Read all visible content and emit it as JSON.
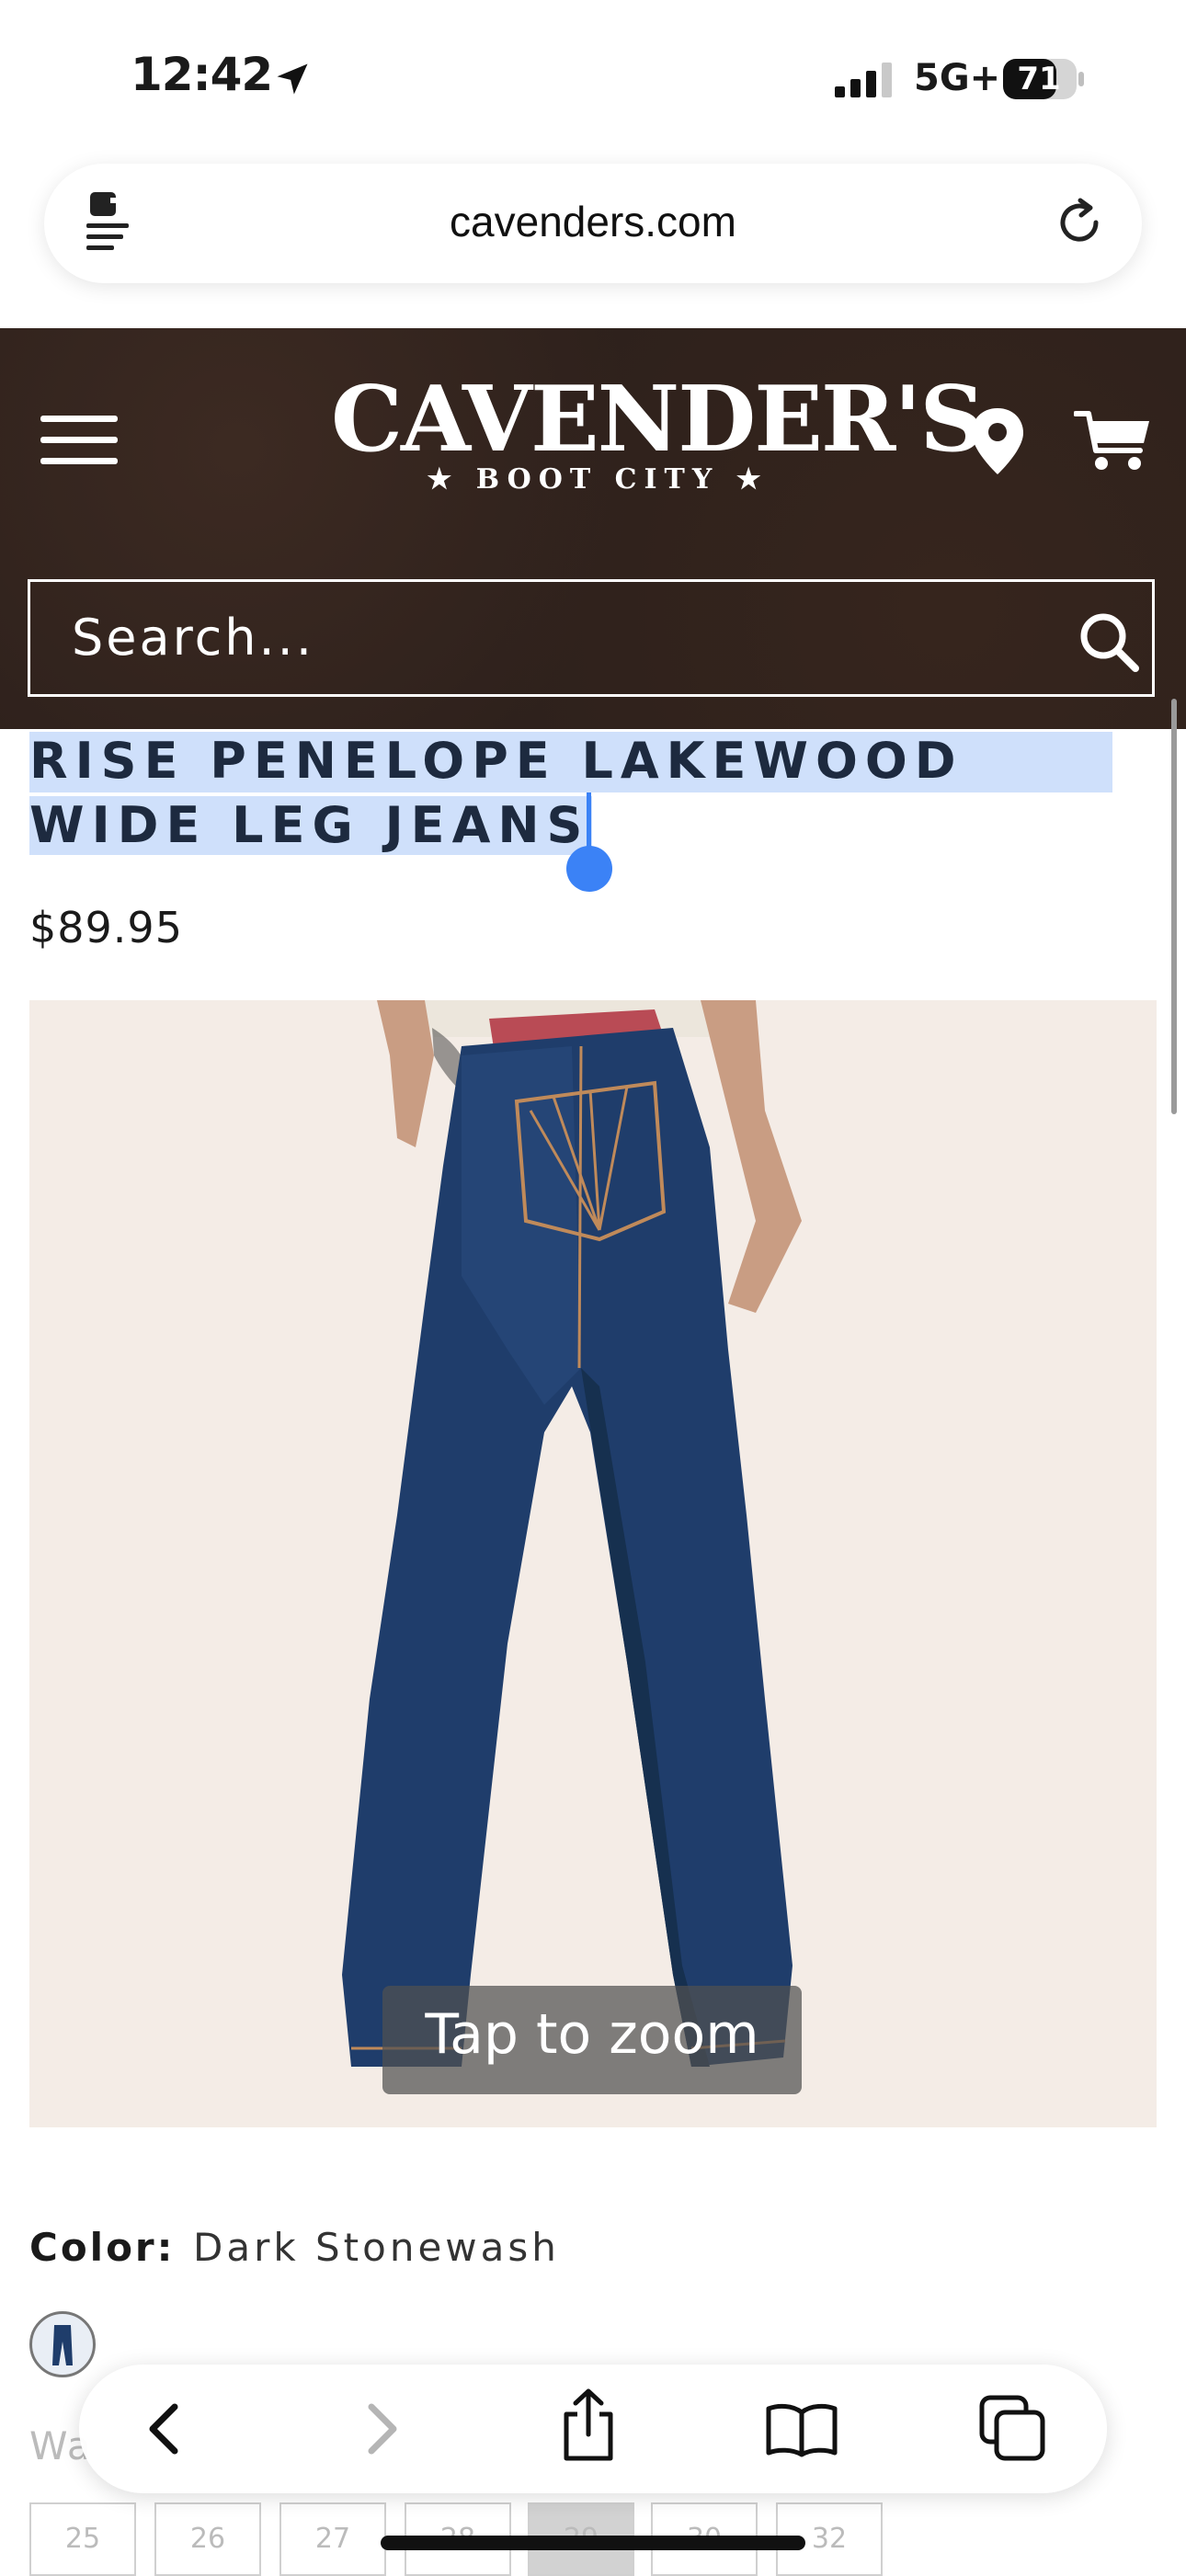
{
  "status_bar": {
    "time": "12:42",
    "network": "5G+",
    "battery": "71"
  },
  "browser": {
    "url": "cavenders.com"
  },
  "header": {
    "logo_name": "CAVENDER'S",
    "logo_sub": "★ BOOT CITY ★",
    "search_placeholder": "Search..."
  },
  "product": {
    "title_line_1": "RISE PENELOPE LAKEWOOD",
    "title_line_2": "WIDE LEG JEANS",
    "price": "$89.95",
    "image_overlay": "Tap to zoom",
    "color_label": "Color:",
    "color_value": "Dark Stonewash",
    "waist_label": "Wa",
    "sizes": [
      "25",
      "26",
      "27",
      "28",
      "29",
      "30",
      "32"
    ]
  },
  "colors": {
    "header_bg": "#2e211c",
    "selection": "#cfe0fb",
    "selection_handle": "#3b82f6",
    "image_bg": "#f4ece6",
    "denim": "#1f3d6b"
  },
  "icons": {
    "menu": "hamburger-icon",
    "location": "map-pin-icon",
    "cart": "shopping-cart-icon",
    "search": "magnifier-icon",
    "reload": "reload-icon",
    "reader": "reader-icon",
    "back": "chevron-left-icon",
    "forward": "chevron-right-icon",
    "share": "share-icon",
    "bookmarks": "book-icon",
    "tabs": "tabs-icon"
  }
}
